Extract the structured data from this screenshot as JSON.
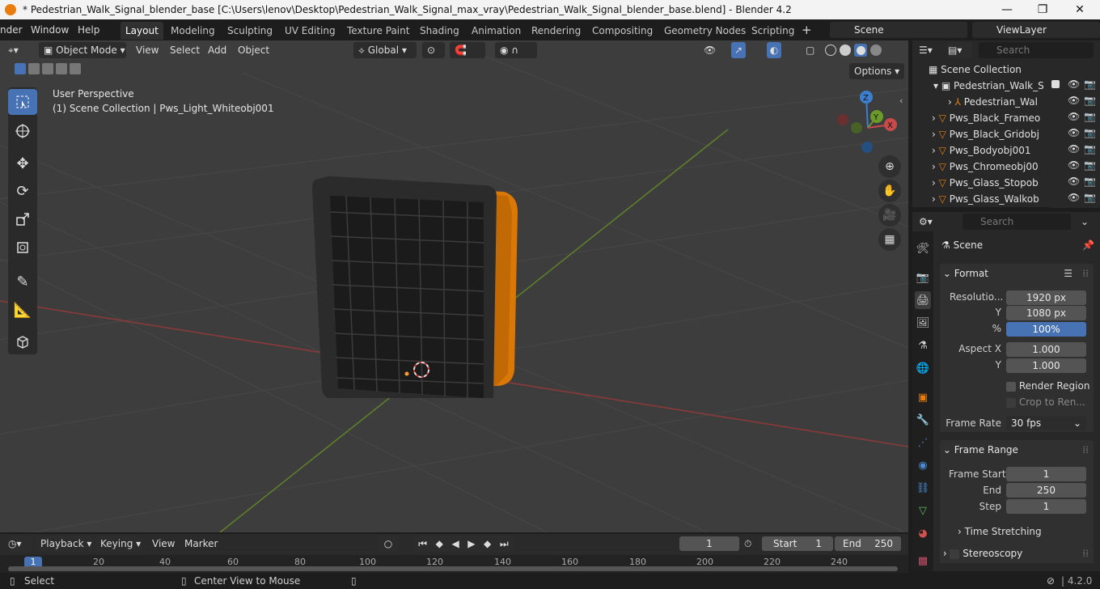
{
  "window": {
    "title": "* Pedestrian_Walk_Signal_blender_base [C:\\Users\\lenov\\Desktop\\Pedestrian_Walk_Signal_max_vray\\Pedestrian_Walk_Signal_blender_base.blend] - Blender 4.2",
    "minimize_icon": "—",
    "maximize_icon": "❐",
    "close_icon": "✕"
  },
  "menu": {
    "items": [
      "nder",
      "Window",
      "Help"
    ],
    "workspaces": [
      "Layout",
      "Modeling",
      "Sculpting",
      "UV Editing",
      "Texture Paint",
      "Shading",
      "Animation",
      "Rendering",
      "Compositing",
      "Geometry Nodes",
      "Scripting"
    ],
    "add_tab": "+",
    "scene": "Scene",
    "view_layer": "ViewLayer"
  },
  "viewport_header": {
    "mode": "Object Mode",
    "menus": [
      "View",
      "Select",
      "Add",
      "Object"
    ],
    "transform_orientation": "Global",
    "options": "Options"
  },
  "viewport": {
    "perspective": "User Perspective",
    "collection_info": "(1) Scene Collection | Pws_Light_Whiteobj001",
    "gizmo": {
      "z": "Z",
      "y": "Y",
      "x": "X"
    }
  },
  "outliner": {
    "search_placeholder": "Search",
    "root": "Scene Collection",
    "items": [
      {
        "label": "Pedestrian_Walk_S"
      },
      {
        "label": "Pedestrian_Wal"
      },
      {
        "label": "Pws_Black_Frameo"
      },
      {
        "label": "Pws_Black_Gridobj"
      },
      {
        "label": "Pws_Bodyobj001"
      },
      {
        "label": "Pws_Chromeobj00"
      },
      {
        "label": "Pws_Glass_Stopob"
      },
      {
        "label": "Pws_Glass_Walkob"
      }
    ]
  },
  "properties": {
    "search_placeholder": "Search",
    "context": "Scene",
    "format_section": "Format",
    "resolution_label": "Resolutio...",
    "resolution_x": "1920 px",
    "y_label": "Y",
    "resolution_y": "1080 px",
    "pct_label": "%",
    "resolution_pct": "100%",
    "aspect_x_label": "Aspect X",
    "aspect_x": "1.000",
    "aspect_y": "1.000",
    "render_region": "Render Region",
    "crop": "Crop to Ren...",
    "frame_rate_label": "Frame Rate",
    "frame_rate": "30 fps",
    "frame_range_section": "Frame Range",
    "frame_start_label": "Frame Start",
    "frame_start": "1",
    "end_label": "End",
    "end": "250",
    "step_label": "Step",
    "step": "1",
    "time_stretching": "Time Stretching",
    "stereoscopy": "Stereoscopy"
  },
  "timeline": {
    "menus": [
      "Playback",
      "Keying",
      "View",
      "Marker"
    ],
    "current_frame": "1",
    "start_label": "Start",
    "start": "1",
    "end_label": "End",
    "end": "250",
    "ruler": [
      "1",
      "20",
      "40",
      "60",
      "80",
      "100",
      "120",
      "140",
      "160",
      "180",
      "200",
      "220",
      "240"
    ]
  },
  "status": {
    "select": "Select",
    "center_view": "Center View to Mouse",
    "version": "4.2.0"
  },
  "colors": {
    "accent": "#4772b3",
    "orange": "#e87d0d",
    "x_axis": "#c84a4a",
    "y_axis": "#6a9a2a",
    "z_axis": "#3c7fcf"
  }
}
